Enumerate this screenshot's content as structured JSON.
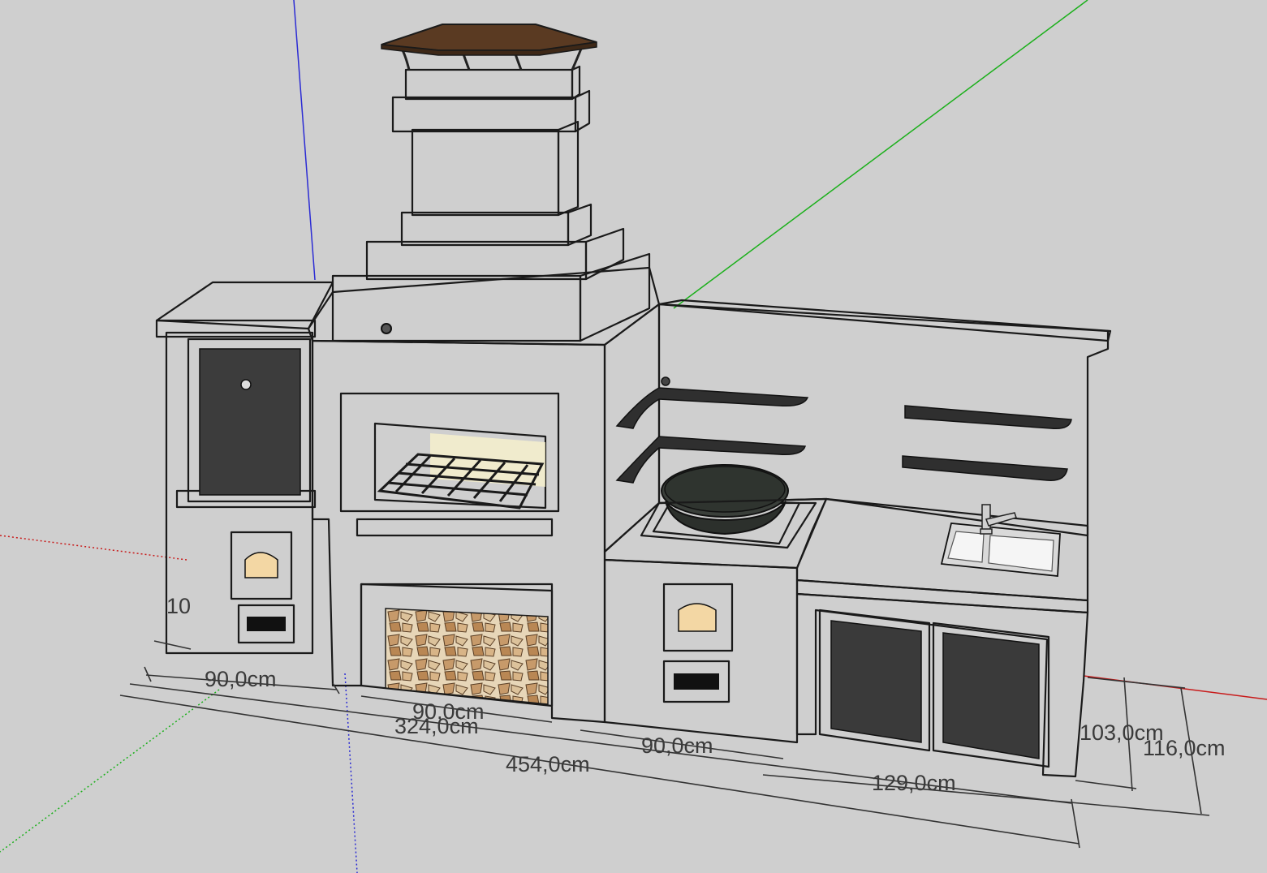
{
  "colors": {
    "background": "#cfcfcf",
    "brick": "#ef6b3b",
    "brick_top": "#e35a30",
    "brick_shadow": "#c84a26",
    "mortar": "#2a2018",
    "door_dark": "#3c3c3c",
    "countertop": "#2b2b2b",
    "roof": "#5a3a22",
    "axis_blue": "#2b2bd4",
    "axis_green": "#1bb01b",
    "axis_red": "#c81a1a",
    "firebox_light": "#f7eebd",
    "firewood": "#c9a479"
  },
  "icons": {
    "cauldron": "kazan-wok-icon",
    "sink": "double-sink-icon",
    "faucet": "faucet-icon",
    "grill": "grill-grate-icon",
    "firewood": "firewood-stack-icon",
    "chimney_cap": "chimney-cap-icon"
  },
  "dimensions": {
    "left_section_width": "90,0cm",
    "grill_section_width": "90,0cm",
    "overall_324": "324,0cm",
    "overall_454": "454,0cm",
    "cauldron_section_width": "90,0cm",
    "sink_section_width": "129,0cm",
    "height_103": "103,0cm",
    "height_116": "116,0cm",
    "partial_left": "10"
  }
}
